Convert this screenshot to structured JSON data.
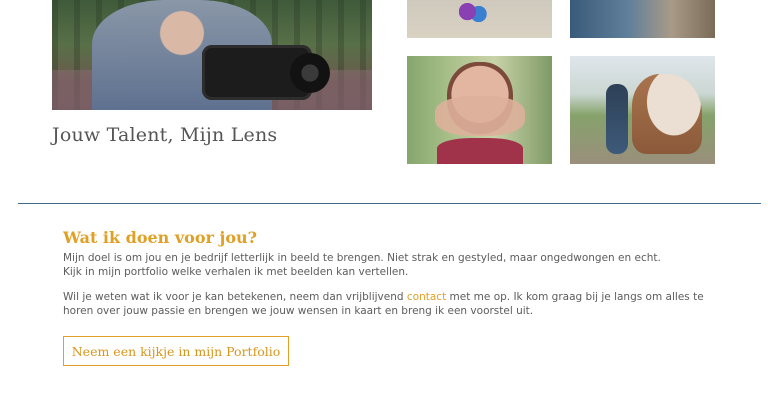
{
  "hero": {
    "caption": "Jouw Talent, Mijn Lens"
  },
  "section": {
    "title": "Wat ik doen voor jou?",
    "paragraph_1_line_1": "Mijn doel is om jou en je bedrijf letterlijk in beeld te brengen. Niet strak en gestyled, maar ongedwongen en echt.",
    "paragraph_1_line_2": "Kijk in mijn portfolio welke verhalen ik met beelden kan vertellen.",
    "paragraph_2_before_link": "Wil je weten wat ik voor je kan betekenen, neem dan vrijblijvend ",
    "contact_link": "contact",
    "paragraph_2_after_link": " met me op. Ik kom graag bij je langs om alles te horen over jouw passie en brengen we jouw wensen in kaart en breng ik een voorstel uit.",
    "button_label": "Neem een kijkje in mijn Portfolio"
  },
  "colors": {
    "accent": "#e0a025",
    "divider": "#3f6a8e",
    "text": "#5c5c5c"
  }
}
